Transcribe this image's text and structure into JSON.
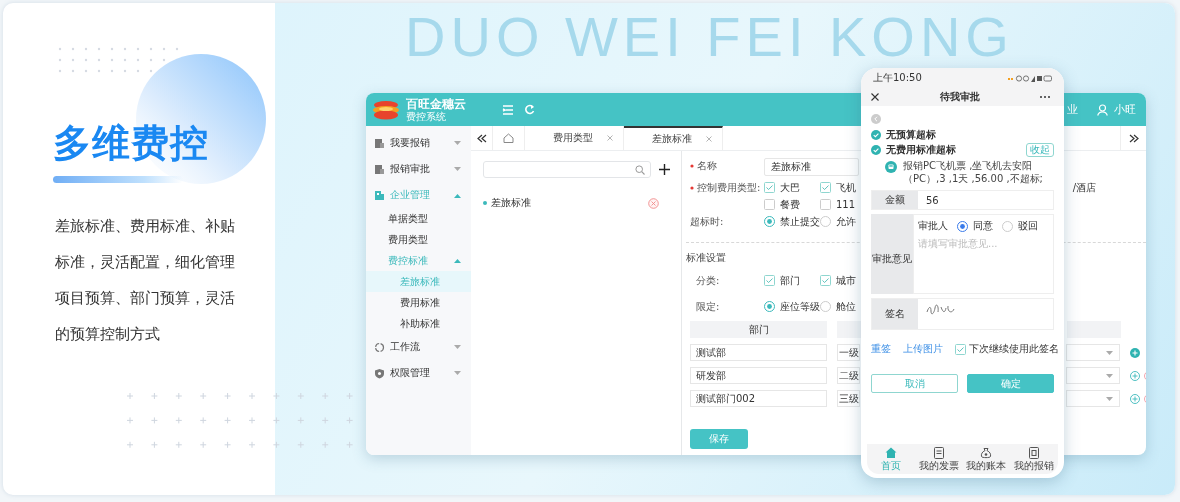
{
  "background_text": "DUO WEI FEI KONG",
  "intro": {
    "title": "多维费控",
    "description": "差旅标准、费用标准、补贴标准，灵活配置，细化管理项目预算、部门预算，灵活的预算控制方式"
  },
  "desktop_app": {
    "brand": {
      "name": "百旺金穗云",
      "subtitle": "费控系统"
    },
    "header_right": {
      "cut_text": "业",
      "user": "小旺"
    },
    "sidebar": [
      {
        "label": "我要报销",
        "kind": "doc",
        "expanded": false
      },
      {
        "label": "报销审批",
        "kind": "doc",
        "expanded": false
      },
      {
        "label": "企业管理",
        "kind": "building",
        "expanded": true,
        "children": [
          {
            "label": "单据类型",
            "selected": false
          },
          {
            "label": "费用类型",
            "selected": false
          },
          {
            "label": "费控标准",
            "selected": false,
            "expanded": true,
            "children": [
              {
                "label": "差旅标准",
                "selected": true
              },
              {
                "label": "费用标准",
                "selected": false
              },
              {
                "label": "补助标准",
                "selected": false
              }
            ]
          }
        ]
      },
      {
        "label": "工作流",
        "kind": "flow",
        "expanded": false
      },
      {
        "label": "权限管理",
        "kind": "shield",
        "expanded": false
      }
    ],
    "tabs": [
      {
        "label": "费用类型",
        "selected": false
      },
      {
        "label": "差旅标准",
        "selected": true
      }
    ],
    "tree": [
      {
        "label": "差旅标准"
      }
    ],
    "form": {
      "fields": [
        {
          "label": "名称",
          "required": true,
          "kind": "text",
          "value": "差旅标准"
        },
        {
          "label": "控制费用类型:",
          "required": true,
          "kind": "checkboxes",
          "options": [
            {
              "label": "大巴",
              "checked": true
            },
            {
              "label": "飞机",
              "checked": true
            },
            {
              "label": "餐费",
              "checked": false
            },
            {
              "label": "111",
              "checked": false
            }
          ],
          "cut_option": "/酒店"
        },
        {
          "label": "超标时:",
          "required": false,
          "kind": "radios",
          "options": [
            {
              "label": "禁止提交",
              "selected": true
            },
            {
              "label": "允许",
              "selected": false
            }
          ]
        }
      ],
      "section_title": "标准设置",
      "criteria": [
        {
          "label": "分类:",
          "required": false,
          "kind": "checkboxes",
          "options": [
            {
              "label": "部门",
              "checked": true
            },
            {
              "label": "城市",
              "checked": true
            }
          ]
        },
        {
          "label": "限定:",
          "required": false,
          "kind": "radios",
          "options": [
            {
              "label": "座位等级",
              "selected": true
            },
            {
              "label": "舱位",
              "selected": false
            }
          ]
        }
      ],
      "table": {
        "columns": [
          "部门"
        ],
        "rows": [
          {
            "department": "测试部",
            "level": "一级",
            "removable": false
          },
          {
            "department": "研发部",
            "level": "二级",
            "removable": true
          },
          {
            "department": "测试部门002",
            "level": "三级",
            "removable": true
          }
        ]
      },
      "save_button": "保存"
    }
  },
  "phone": {
    "time": "上午10:50",
    "title": "待我审批",
    "checks": [
      {
        "label": "无预算超标"
      },
      {
        "label": "无费用标准超标",
        "action": "收起"
      }
    ],
    "detail": "报销PC飞机票 ,坐飞机去安阳（PC）,3 ,1天 ,56.00 ,不超标;",
    "amount": {
      "label": "金额",
      "value": "56"
    },
    "opinion": {
      "label": "审批意见",
      "approver_label": "审批人",
      "choices": [
        {
          "label": "同意",
          "selected": true
        },
        {
          "label": "驳回",
          "selected": false
        }
      ],
      "placeholder": "请填写审批意见..."
    },
    "signature": {
      "label": "签名"
    },
    "links": [
      "重签",
      "上传图片"
    ],
    "remember": {
      "label": "下次继续使用此签名",
      "checked": true
    },
    "buttons": [
      {
        "label": "取消",
        "kind": "secondary"
      },
      {
        "label": "确定",
        "kind": "primary"
      }
    ],
    "nav": [
      {
        "label": "首页",
        "kind": "home",
        "selected": true
      },
      {
        "label": "我的发票",
        "kind": "invoice",
        "selected": false
      },
      {
        "label": "我的账本",
        "kind": "ledger",
        "selected": false
      },
      {
        "label": "我的报销",
        "kind": "report",
        "selected": false
      }
    ]
  }
}
